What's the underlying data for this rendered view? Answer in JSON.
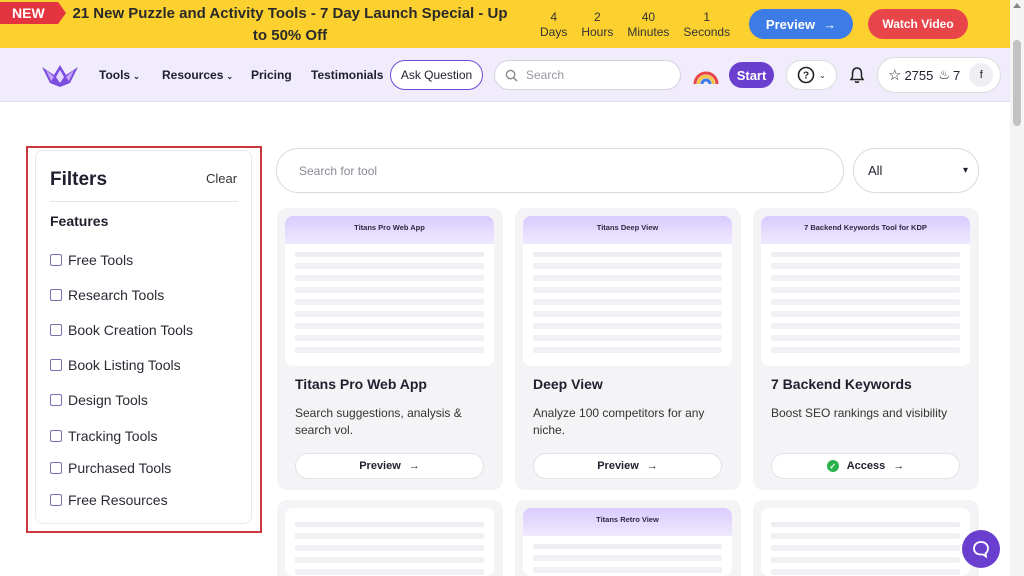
{
  "promo": {
    "badge": "NEW",
    "text": "21 New Puzzle and Activity Tools - 7 Day Launch Special - Up to 50% Off",
    "countdown": [
      {
        "value": "4",
        "unit": "Days"
      },
      {
        "value": "2",
        "unit": "Hours"
      },
      {
        "value": "40",
        "unit": "Minutes"
      },
      {
        "value": "1",
        "unit": "Seconds"
      }
    ],
    "preview_label": "Preview",
    "watch_label": "Watch Video"
  },
  "nav": {
    "tools": "Tools",
    "resources": "Resources",
    "pricing": "Pricing",
    "testimonials": "Testimonials",
    "ask": "Ask Question",
    "search_placeholder": "Search",
    "start": "Start",
    "points": "2755",
    "streak": "7",
    "avatar": "f"
  },
  "filters": {
    "title": "Filters",
    "clear": "Clear",
    "section": "Features",
    "items": [
      "Free Tools",
      "Research Tools",
      "Book Creation Tools",
      "Book Listing Tools",
      "Design Tools",
      "Tracking Tools",
      "Purchased Tools",
      "Free Resources"
    ]
  },
  "tool_search": {
    "placeholder": "Search for tool",
    "select_value": "All"
  },
  "cards": [
    {
      "thumb_title": "Titans Pro Web App",
      "title": "Titans Pro Web App",
      "desc": "Search suggestions, analysis & search vol.",
      "button": "Preview"
    },
    {
      "thumb_title": "Titans Deep View",
      "title": "Deep View",
      "desc": "Analyze 100 competitors for any niche.",
      "button": "Preview"
    },
    {
      "thumb_title": "7 Backend Keywords Tool for KDP",
      "title": "7 Backend Keywords",
      "desc": "Boost SEO rankings and visibility",
      "button": "Access"
    },
    {
      "thumb_title": "",
      "title": "",
      "desc": "",
      "button": ""
    },
    {
      "thumb_title": "Titans Retro View",
      "title": "",
      "desc": "",
      "button": ""
    },
    {
      "thumb_title": "",
      "title": "",
      "desc": "",
      "button": ""
    }
  ],
  "colors": {
    "promo_bg": "#fcd12f",
    "brand_purple": "#6a3fd0",
    "preview_blue": "#3d7be6",
    "watch_red": "#e8454b",
    "highlight_red": "#c9383f"
  }
}
